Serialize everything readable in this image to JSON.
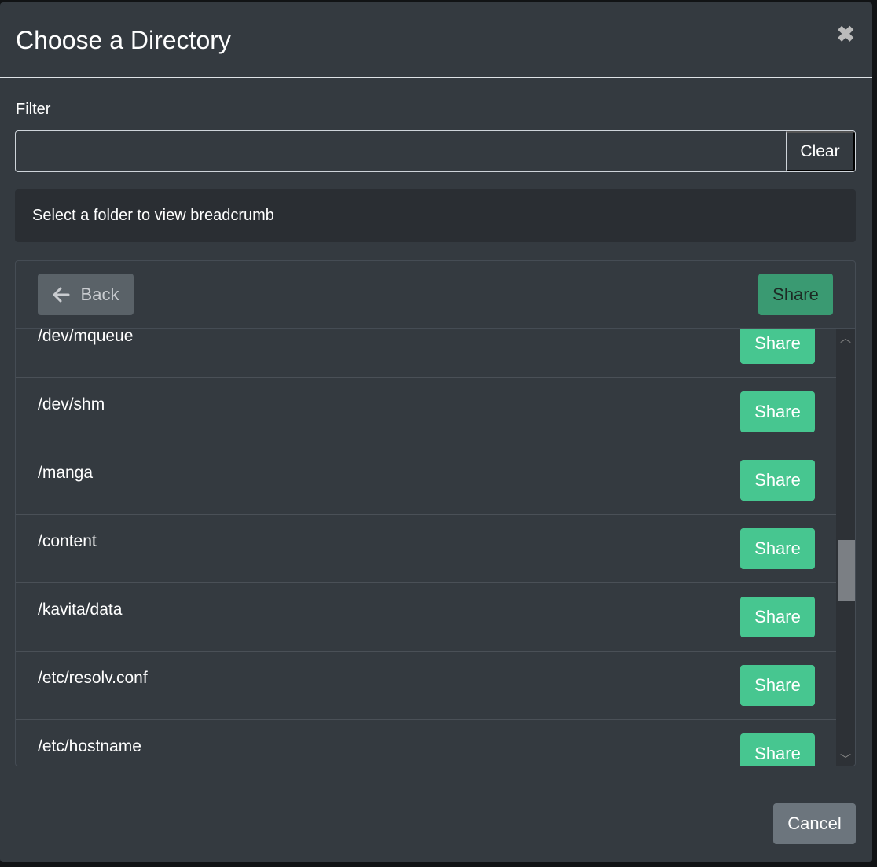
{
  "modal": {
    "title": "Choose a Directory",
    "close_icon": "close-icon"
  },
  "filter": {
    "label": "Filter",
    "value": "",
    "placeholder": "",
    "clear_label": "Clear"
  },
  "breadcrumb": {
    "text": "Select a folder to view breadcrumb"
  },
  "toolbar": {
    "back_label": "Back",
    "share_label": "Share"
  },
  "directories": [
    {
      "path": "/dev/mqueue",
      "action": "Share"
    },
    {
      "path": "/dev/shm",
      "action": "Share"
    },
    {
      "path": "/manga",
      "action": "Share"
    },
    {
      "path": "/content",
      "action": "Share"
    },
    {
      "path": "/kavita/data",
      "action": "Share"
    },
    {
      "path": "/etc/resolv.conf",
      "action": "Share"
    },
    {
      "path": "/etc/hostname",
      "action": "Share"
    }
  ],
  "colors": {
    "share": "#47c690",
    "modal_bg": "#343a40",
    "cancel": "#6c757d"
  },
  "footer": {
    "cancel_label": "Cancel"
  }
}
